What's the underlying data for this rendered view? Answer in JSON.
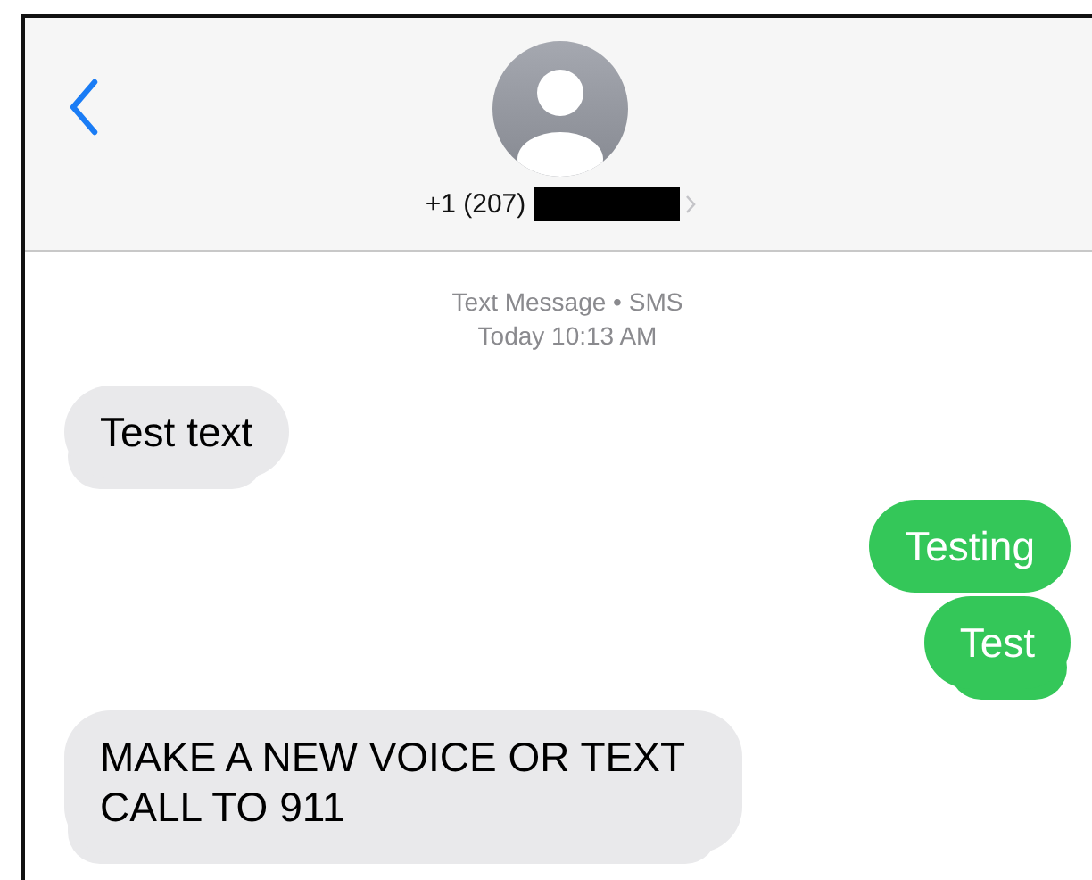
{
  "header": {
    "phone_prefix": "+1 (207)",
    "number_redacted": true
  },
  "thread_info": {
    "service": "Text Message • SMS",
    "time": "Today 10:13 AM"
  },
  "messages": [
    {
      "kind": "incoming",
      "text": "Test text",
      "tail": true
    },
    {
      "kind": "outgoing",
      "text": "Testing",
      "tail": false
    },
    {
      "kind": "outgoing",
      "text": "Test",
      "tail": true
    },
    {
      "kind": "incoming",
      "text": "MAKE A NEW VOICE OR TEXT CALL TO 911",
      "tail": true
    }
  ]
}
